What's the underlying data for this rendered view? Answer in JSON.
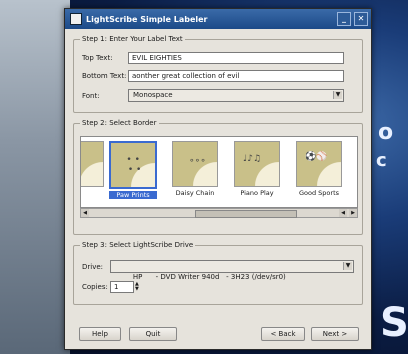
{
  "window": {
    "title": "LightScribe Simple Labeler"
  },
  "step1": {
    "title": "Step 1: Enter Your Label Text",
    "top_label": "Top Text:",
    "top_value": "EVIL EIGHTIES",
    "bottom_label": "Bottom Text:",
    "bottom_value": "aonther great collection of evil",
    "font_label": "Font:",
    "font_value": "Monospace"
  },
  "step2": {
    "title": "Step 2: Select Border",
    "borders": [
      "Paw Prints",
      "Daisy Chain",
      "Piano Play",
      "Good Sports"
    ],
    "selected": "Paw Prints"
  },
  "step3": {
    "title": "Step 3: Select LightScribe Drive",
    "drive_label": "Drive:",
    "drive_value": "HP      - DVD Writer 940d   - 3H23 (/dev/sr0)",
    "copies_label": "Copies:",
    "copies_value": "1"
  },
  "buttons": {
    "help": "Help",
    "quit": "Quit",
    "back": "< Back",
    "next": "Next >"
  }
}
